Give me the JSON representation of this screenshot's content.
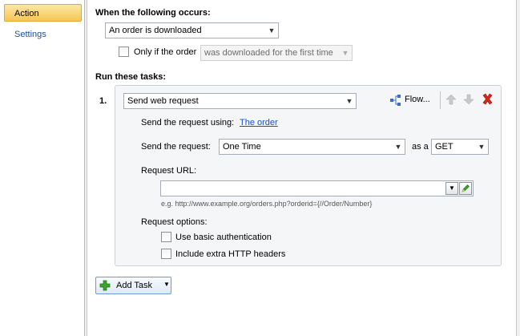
{
  "nav": {
    "items": [
      {
        "label": "Action",
        "active": true
      },
      {
        "label": "Settings",
        "active": false
      }
    ]
  },
  "trigger": {
    "heading": "When the following occurs:",
    "event_value": "An order is downloaded",
    "only_if_label": "Only if the order",
    "only_if_checked": false,
    "only_if_value": "was downloaded for the first time"
  },
  "tasks": {
    "heading": "Run these tasks:",
    "items": [
      {
        "number": "1.",
        "type_value": "Send web request",
        "flow_label": "Flow...",
        "send_using_label": "Send the request using:",
        "send_using_link": "The order",
        "send_request_label": "Send the request:",
        "send_request_value": "One Time",
        "as_a_label": "as a",
        "method_value": "GET",
        "url_label": "Request URL:",
        "url_value": "",
        "url_hint": "e.g. http://www.example.org/orders.php?orderid={//Order/Number}",
        "options_label": "Request options:",
        "options": [
          {
            "label": "Use basic authentication",
            "checked": false
          },
          {
            "label": "Include extra HTTP headers",
            "checked": false
          }
        ]
      }
    ]
  },
  "add_task": {
    "label": "Add Task"
  },
  "icons": {
    "flow": "flow-icon",
    "up": "arrow-up-icon",
    "down": "arrow-down-icon",
    "delete": "red-x-icon",
    "add": "green-plus-icon",
    "edit": "pencil-icon"
  },
  "colors": {
    "accent": "#f7c652",
    "link": "#1a4fc3",
    "delete": "#d9271c",
    "add": "#3aa52b"
  }
}
